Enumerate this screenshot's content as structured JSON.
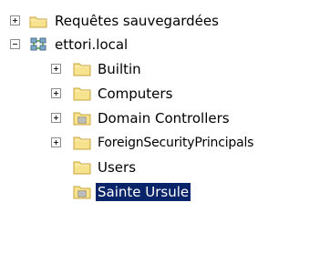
{
  "tree": {
    "nodes": [
      {
        "label": "Requêtes sauvegardées",
        "expander": "plus",
        "icon": "folder-icon"
      },
      {
        "label": "ettori.local",
        "expander": "minus",
        "icon": "domain-icon"
      },
      {
        "label": "Builtin",
        "expander": "plus",
        "icon": "folder-icon"
      },
      {
        "label": "Computers",
        "expander": "plus",
        "icon": "folder-icon"
      },
      {
        "label": "Domain Controllers",
        "expander": "plus",
        "icon": "ou-icon"
      },
      {
        "label": "ForeignSecurityPrincipals",
        "expander": "plus",
        "icon": "folder-icon"
      },
      {
        "label": "Users",
        "expander": "none",
        "icon": "folder-icon"
      },
      {
        "label": "Sainte Ursule",
        "expander": "none",
        "icon": "ou-icon",
        "selected": true
      }
    ],
    "colors": {
      "selection_background": "#0a246a",
      "selection_text": "#ffffff",
      "folder_fill": "#f7e28d",
      "folder_stroke": "#c7a43b"
    }
  }
}
